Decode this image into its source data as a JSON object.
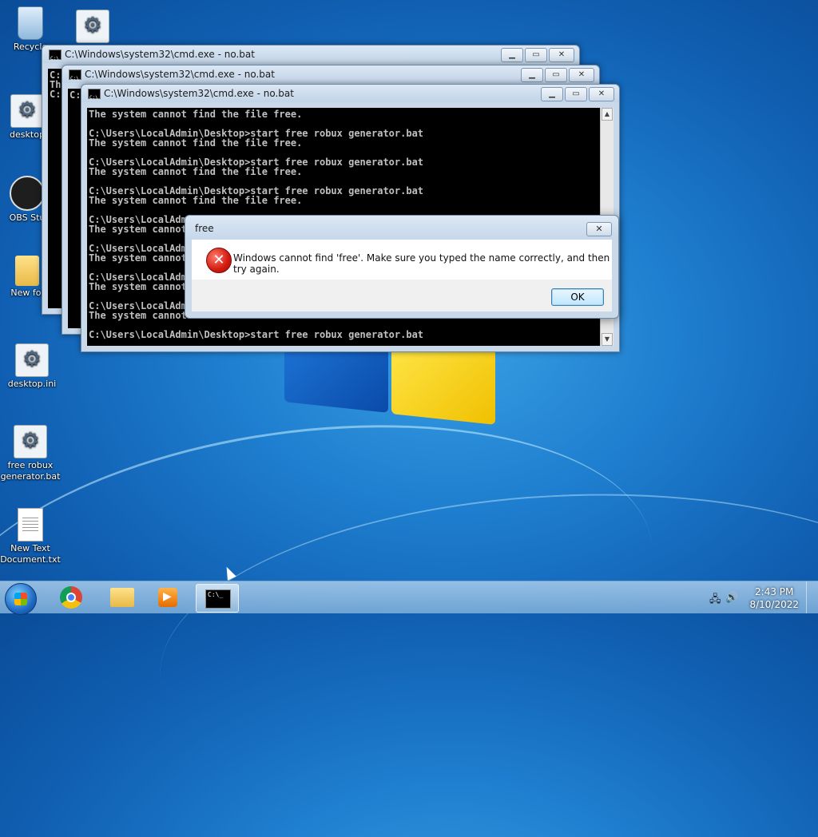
{
  "desktop": {
    "icons": [
      {
        "label": "Recycle",
        "icon": "recycle-bin-icon"
      },
      {
        "label": "",
        "icon": "settings-gear-icon"
      },
      {
        "label": "desktop",
        "icon": "settings-gear-icon"
      },
      {
        "label": "OBS Stu",
        "icon": "obs-studio-icon"
      },
      {
        "label": "New fol",
        "icon": "folder-icon"
      },
      {
        "label": "desktop.ini",
        "icon": "settings-gear-icon"
      },
      {
        "label": "free robux\ngenerator.bat",
        "icon": "batch-file-icon"
      },
      {
        "label": "New Text\nDocument.txt",
        "icon": "text-document-icon"
      }
    ]
  },
  "windows": [
    {
      "title": "C:\\Windows\\system32\\cmd.exe - no.bat",
      "lines": [
        "C:",
        "Th",
        "",
        "C:"
      ]
    },
    {
      "title": "C:\\Windows\\system32\\cmd.exe - no.bat",
      "lines": [
        "C:",
        ""
      ]
    },
    {
      "title": "C:\\Windows\\system32\\cmd.exe - no.bat",
      "lines": [
        "The system cannot find the file free.",
        "",
        "C:\\Users\\LocalAdmin\\Desktop>start free robux generator.bat",
        "The system cannot find the file free.",
        "",
        "C:\\Users\\LocalAdmin\\Desktop>start free robux generator.bat",
        "The system cannot find the file free.",
        "",
        "C:\\Users\\LocalAdmin\\Desktop>start free robux generator.bat",
        "The system cannot find the file free.",
        "",
        "C:\\Users\\LocalAdmin\\Desktop>start free robux generator.bat",
        "The system cannot find the file free.",
        "",
        "C:\\Users\\LocalAdmin\\Desktop>start free robux generator.bat",
        "The system cannot find the file free.",
        "",
        "C:\\Users\\LocalAdmin\\Desktop>start free robux generator.bat",
        "The system cannot find the file free.",
        "",
        "C:\\Users\\LocalAdmin\\Desktop>start free robux generator.bat",
        "The system cannot find the file free.",
        "",
        "C:\\Users\\LocalAdmin\\Desktop>start free robux generator.bat"
      ]
    }
  ],
  "window_controls": {
    "minimize": "▁",
    "maximize": "▭",
    "close": "✕"
  },
  "dialog": {
    "title": "free",
    "close": "✕",
    "icon": "error-icon",
    "message": "Windows cannot find 'free'. Make sure you typed the name correctly, and then try again.",
    "ok_label": "OK"
  },
  "taskbar": {
    "items": [
      {
        "name": "chrome",
        "icon": "chrome-icon"
      },
      {
        "name": "file-explorer",
        "icon": "folder-icon"
      },
      {
        "name": "media-player",
        "icon": "media-player-icon"
      },
      {
        "name": "command-prompt",
        "icon": "cmd-icon",
        "active": true
      }
    ],
    "time": "2:43 PM",
    "date": "8/10/2022"
  }
}
